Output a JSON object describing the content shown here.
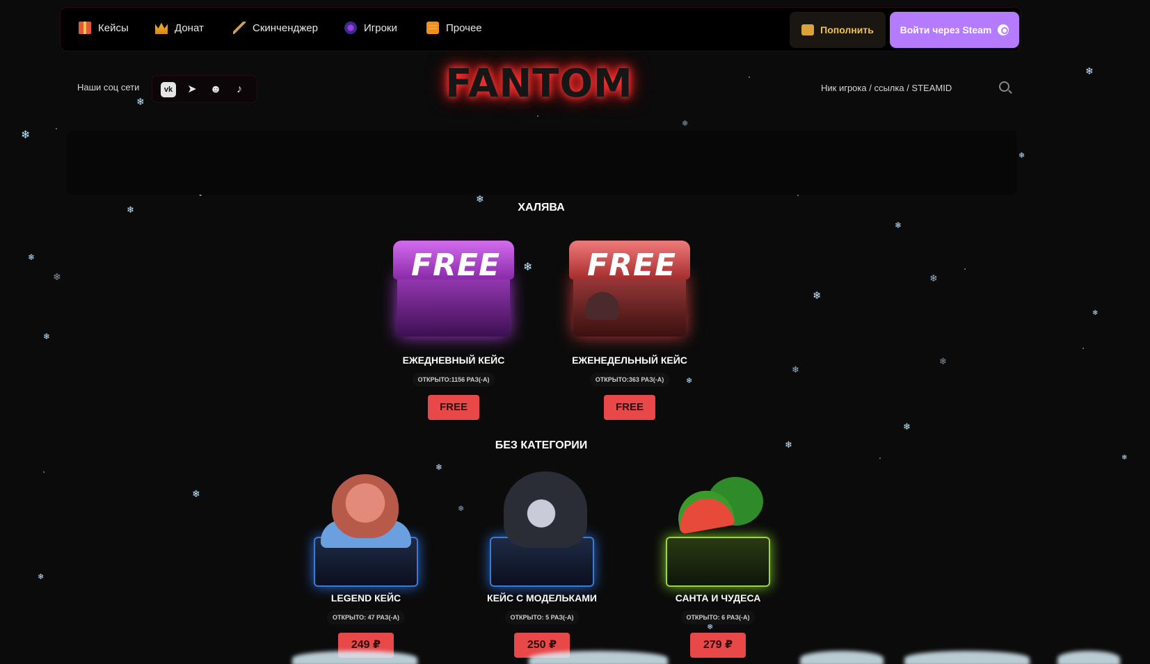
{
  "nav": {
    "items": [
      {
        "label": "Кейсы",
        "icon": "gift-icon"
      },
      {
        "label": "Донат",
        "icon": "crown-icon"
      },
      {
        "label": "Скинченджер",
        "icon": "rifle-icon"
      },
      {
        "label": "Игроки",
        "icon": "player-icon"
      },
      {
        "label": "Прочее",
        "icon": "ticket-icon"
      }
    ],
    "topup_label": "Пополнить",
    "steam_label": "Войти через Steam"
  },
  "social": {
    "label": "Наши соц сети",
    "networks": [
      "vk-icon",
      "telegram-icon",
      "discord-icon",
      "tiktok-icon"
    ]
  },
  "logo": "FANTOM",
  "search": {
    "placeholder": "Ник игрока / ссылка / STEAMID"
  },
  "sections": {
    "free": {
      "title": "ХАЛЯВА",
      "cases": [
        {
          "name": "ЕЖЕДНЕВНЫЙ КЕЙС",
          "opened": "ОТКРЫТО:1156 РАЗ(-А)",
          "price": "FREE",
          "art_text": "FREE"
        },
        {
          "name": "ЕЖЕНЕДЕЛЬНЫЙ КЕЙС",
          "opened": "ОТКРЫТО:363 РАЗ(-А)",
          "price": "FREE",
          "art_text": "FREE"
        }
      ]
    },
    "uncategorized": {
      "title": "БЕЗ КАТЕГОРИИ",
      "cases": [
        {
          "name": "LEGEND КЕЙС",
          "opened": "ОТКРЫТО: 47 РАЗ(-А)",
          "price": "249 ₽"
        },
        {
          "name": "КЕЙС С МОДЕЛЬКАМИ",
          "opened": "ОТКРЫТО: 5 РАЗ(-А)",
          "price": "250 ₽"
        },
        {
          "name": "САНТА И ЧУДЕСА",
          "opened": "ОТКРЫТО: 6 РАЗ(-А)",
          "price": "279 ₽"
        }
      ]
    }
  },
  "colors": {
    "accent_red": "#e84848",
    "steam_purple": "#b57bff",
    "topup_gold": "#f1c24c",
    "background": "#0b0b0b"
  }
}
